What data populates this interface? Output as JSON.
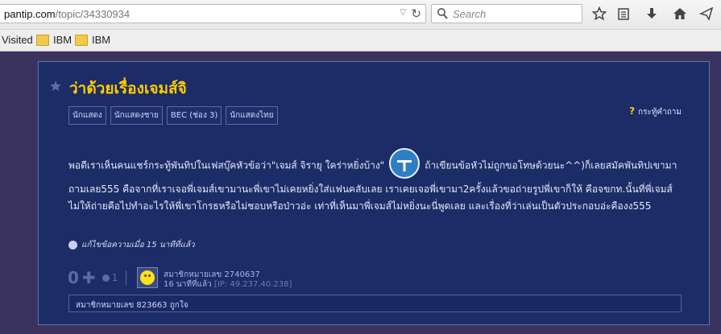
{
  "browser": {
    "url_host": "pantip.com",
    "url_path": "/topic/34330934",
    "search_placeholder": "Search",
    "bookmarks": [
      {
        "label": "Visited"
      },
      {
        "label": "IBM"
      },
      {
        "label": "IBM"
      }
    ]
  },
  "topic": {
    "title": "ว่าด้วยเรื่องเจมส์จิ",
    "tags": [
      "นักแสดง",
      "นักแสดงชาย",
      "BEC (ช่อง 3)",
      "นักแสดงไทย"
    ],
    "ask_label": "กระทู้คำถาม",
    "body_before": "พอดีเราเห็นคนแชร์กระทู้พันทิปในเฟสบุ๊คหัวข้อว่า\"เจมส์ จิรายุ ใคร่าหยิ่งบ้าง\"",
    "body_after": "ถ้าเขียนข้อหัวไม่ถูกขอโทษด้วยนะ^^)ก็เลยสมัคพันทิปเขามาถามเลย555 คือจากที่เราเจอพี่เจมส์เขามานะพี่เขาไม่เคยหยิ่งใส่แฟนคลับเลย เราเคยเจอพี่เขามา2ครั้งแล้วขอถ่ายรูปพี่เขาก็ให้ คือจขกท.นั้นที่พี่เจมส์ไม่ให้ถ่ายคือไปทำอะไรให้พี่เขาโกรธหรือไม่ชอบหรือป่าวอ่ะ เท่าที่เห็นมาพี่เจมส์ไม่หยิ่งนะนี่พูดเลย  และเรื่องที่ว่าเล่นเป็นตัวประกอบอ่ะคืองง555",
    "edit_note": "แก้ไขข้อความเมื่อ 15 นาทีที่แล้ว",
    "vote_count": "0",
    "emotion_count": "1",
    "author_name": "สมาชิกหมายเลข 2740637",
    "posted_time": "16 นาทีที่แล้ว",
    "ip": "[IP: 49.237.40.238]",
    "likes_text": "สมาชิกหมายเลข 823663 ถูกใจ"
  },
  "colors": {
    "title": "#ffcc00",
    "card_bg": "#1c2c66",
    "page_bg": "#3a3360"
  }
}
